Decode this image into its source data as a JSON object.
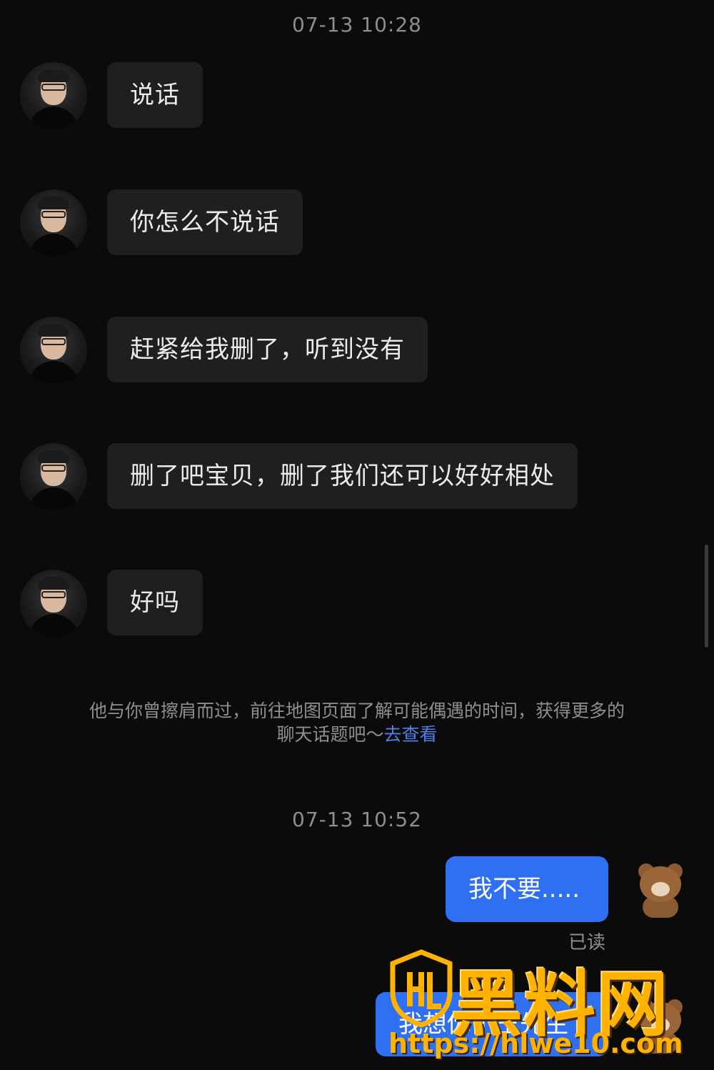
{
  "chat": {
    "timestamp_1": "07-13 10:28",
    "messages_in": [
      {
        "text": "说话"
      },
      {
        "text": "你怎么不说话"
      },
      {
        "text": "赶紧给我删了，听到没有"
      },
      {
        "text": "删了吧宝贝，删了我们还可以好好相处"
      },
      {
        "text": "好吗"
      }
    ],
    "notice": {
      "text": "他与你曾擦肩而过，前往地图页面了解可能偶遇的时间，获得更多的聊天话题吧～",
      "link": "去查看"
    },
    "timestamp_2": "07-13 10:52",
    "messages_out": [
      {
        "text": "我不要.....",
        "status": "已读"
      },
      {
        "text": "我想你了王先生"
      }
    ]
  },
  "watermark": {
    "title": "黑料网",
    "url": "https://hlwe10.com"
  },
  "colors": {
    "background": "#0b0b0c",
    "incoming_bubble": "#1f1f21",
    "outgoing_bubble": "#2f6ff2",
    "link": "#4d7fe8",
    "watermark": "#ffb300"
  },
  "icons": {
    "contact_avatar": "avatar-photo-icon",
    "my_avatar": "teddy-bear-avatar-icon",
    "watermark_logo": "hl-shield-logo-icon"
  }
}
